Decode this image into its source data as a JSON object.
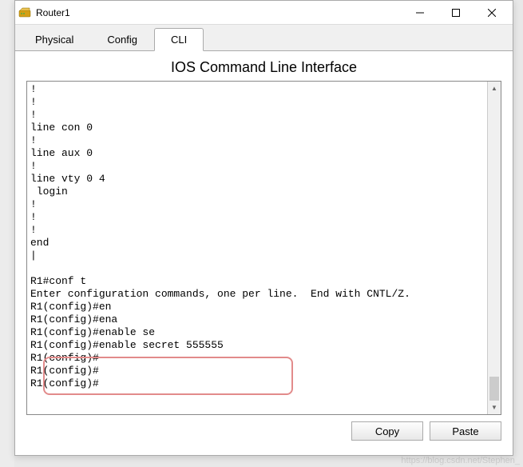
{
  "window": {
    "title": "Router1"
  },
  "tabs": {
    "t0": "Physical",
    "t1": "Config",
    "t2": "CLI"
  },
  "cli": {
    "heading": "IOS Command Line Interface",
    "output": "!\n!\n!\nline con 0\n!\nline aux 0\n!\nline vty 0 4\n login\n!\n!\n!\nend\n|\n\nR1#conf t\nEnter configuration commands, one per line.  End with CNTL/Z.\nR1(config)#en\nR1(config)#ena\nR1(config)#enable se\nR1(config)#enable secret 555555\nR1(config)#\nR1(config)#\nR1(config)#"
  },
  "buttons": {
    "copy": "Copy",
    "paste": "Paste"
  },
  "watermark": "https://blog.csdn.net/Stephen_"
}
